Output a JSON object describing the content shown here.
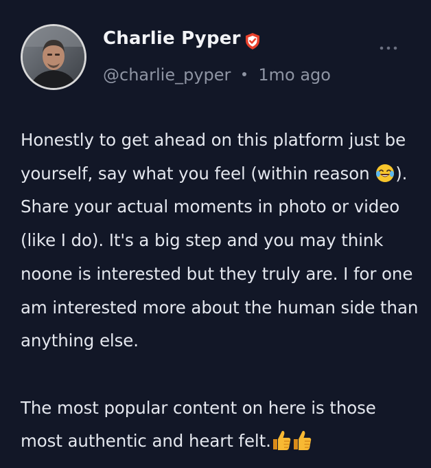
{
  "author": {
    "display_name": "Charlie Pyper",
    "handle": "@charlie_pyper",
    "verified_icon": "shield-check-icon",
    "verified_color": "#e8412c"
  },
  "post": {
    "time": "1mo ago",
    "paragraph1_part1": "Honestly to get ahead on this platform just be yourself, say what you feel (within reason ",
    "paragraph1_emoji": "face-with-tears-of-joy-icon",
    "paragraph1_part2": "). Share your actual moments in photo or video (like I do). It's a big step and you may think noone is interested but they truly are. I for one am interested more about the human side than anything else.",
    "paragraph2_text": "The most popular content on here is those most authentic and heart felt.",
    "paragraph2_emojis": [
      "thumbs-up-icon",
      "thumbs-up-icon"
    ]
  },
  "menu": {
    "icon": "more-horizontal-icon"
  },
  "colors": {
    "background": "#121727",
    "text": "#e4e7ee",
    "muted": "#8e94a3"
  }
}
